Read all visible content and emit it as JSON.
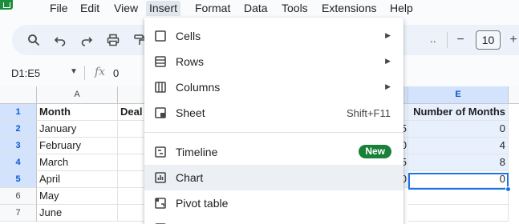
{
  "menubar": {
    "items": [
      {
        "label": "File"
      },
      {
        "label": "Edit"
      },
      {
        "label": "View"
      },
      {
        "label": "Insert"
      },
      {
        "label": "Format"
      },
      {
        "label": "Data"
      },
      {
        "label": "Tools"
      },
      {
        "label": "Extensions"
      },
      {
        "label": "Help"
      }
    ],
    "active_item": "Insert"
  },
  "toolbar": {
    "icons": [
      "search-icon",
      "undo-icon",
      "redo-icon",
      "print-icon",
      "paint-format-icon"
    ],
    "overflow": "..",
    "decrease_label": "−",
    "font_size": "10",
    "increase_label": "+"
  },
  "formula_bar": {
    "name_box": "D1:E5",
    "fx_label": "fx",
    "value": "0"
  },
  "grid": {
    "col_headers": [
      "A",
      "E"
    ],
    "row_headers": [
      "1",
      "2",
      "3",
      "4",
      "5",
      "6",
      "7"
    ],
    "col_a": [
      "Month",
      "January",
      "February",
      "March",
      "April",
      "May",
      "June"
    ],
    "col_b_header": "Deal",
    "col_d_fragments": [
      "5",
      "0",
      "5",
      "0"
    ],
    "col_e": [
      "Number of Months",
      "0",
      "4",
      "8",
      "0"
    ]
  },
  "insert_menu": {
    "items": [
      {
        "label": "Cells",
        "icon": "cells-icon",
        "submenu": true
      },
      {
        "label": "Rows",
        "icon": "rows-icon",
        "submenu": true
      },
      {
        "label": "Columns",
        "icon": "columns-icon",
        "submenu": true
      },
      {
        "label": "Sheet",
        "icon": "sheet-icon",
        "shortcut": "Shift+F11"
      },
      {
        "label": "Timeline",
        "icon": "timeline-icon",
        "badge": "New"
      },
      {
        "label": "Chart",
        "icon": "chart-icon",
        "hovered": true
      },
      {
        "label": "Pivot table",
        "icon": "pivot-table-icon"
      }
    ]
  },
  "colors": {
    "accent": "#1a73e8",
    "selection": "#d3e3fd",
    "badge": "#188038",
    "logo": "#1e8e3e"
  }
}
